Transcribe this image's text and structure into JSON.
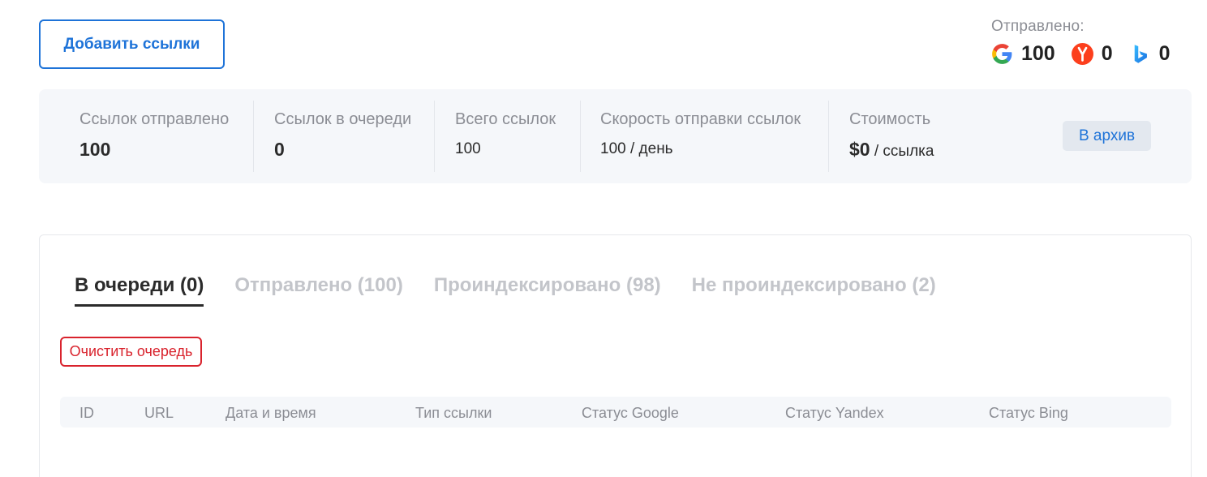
{
  "toolbar": {
    "add_links_label": "Добавить ссылки"
  },
  "sent_summary": {
    "label": "Отправлено:",
    "engines": [
      {
        "icon": "google-icon",
        "count": "100"
      },
      {
        "icon": "yandex-icon",
        "count": "0"
      },
      {
        "icon": "bing-icon",
        "count": "0"
      }
    ]
  },
  "stats": {
    "sent": {
      "label": "Ссылок отправлено",
      "value": "100"
    },
    "queued": {
      "label": "Ссылок в очереди",
      "value": "0"
    },
    "total": {
      "label": "Всего ссылок",
      "value": "100"
    },
    "speed": {
      "label": "Скорость отправки ссылок",
      "value": "100 / день"
    },
    "cost": {
      "label": "Стоимость",
      "value": "$0",
      "suffix": " / ссылка"
    },
    "archive_label": "В архив"
  },
  "tabs": [
    {
      "label": "В очереди (0)",
      "active": true
    },
    {
      "label": "Отправлено (100)",
      "active": false
    },
    {
      "label": "Проиндексировано (98)",
      "active": false
    },
    {
      "label": "Не проиндексировано (2)",
      "active": false
    }
  ],
  "queue": {
    "clear_label": "Очистить очередь"
  },
  "table": {
    "columns": [
      "ID",
      "URL",
      "Дата и время",
      "Тип ссылки",
      "Статус Google",
      "Статус Yandex",
      "Статус Bing"
    ]
  },
  "colors": {
    "accent": "#1e73d8",
    "danger": "#d9232d",
    "panel": "#f5f7fa"
  }
}
